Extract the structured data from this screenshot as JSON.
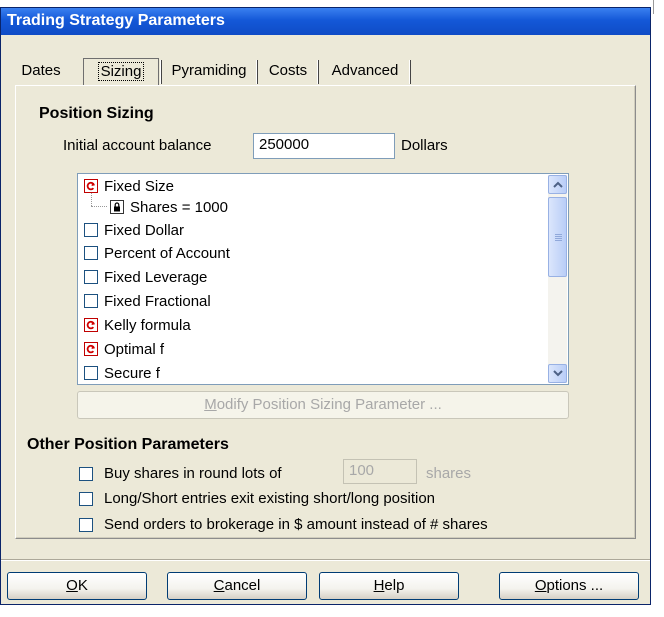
{
  "window": {
    "title": "Trading Strategy Parameters"
  },
  "tabs": [
    {
      "label": "Dates",
      "selected": false
    },
    {
      "label": "Sizing",
      "selected": true
    },
    {
      "label": "Pyramiding",
      "selected": false
    },
    {
      "label": "Costs",
      "selected": false
    },
    {
      "label": "Advanced",
      "selected": false
    }
  ],
  "position_sizing": {
    "heading": "Position Sizing",
    "balance_label": "Initial account balance",
    "balance_value": "250000",
    "balance_unit": "Dollars",
    "list_items": [
      {
        "label": "Fixed Size",
        "icon": "refresh-red-icon",
        "checked": true
      },
      {
        "label": "Shares = 1000",
        "icon": "lock-icon",
        "child": true
      },
      {
        "label": "Fixed Dollar",
        "icon": "checkbox",
        "checked": false
      },
      {
        "label": "Percent of Account",
        "icon": "checkbox",
        "checked": false
      },
      {
        "label": "Fixed Leverage",
        "icon": "checkbox",
        "checked": false
      },
      {
        "label": "Fixed Fractional",
        "icon": "checkbox",
        "checked": false
      },
      {
        "label": "Kelly formula",
        "icon": "refresh-red-icon"
      },
      {
        "label": "Optimal f",
        "icon": "refresh-red-icon"
      },
      {
        "label": "Secure f",
        "icon": "checkbox",
        "checked": false
      }
    ],
    "modify_button_pre": "",
    "modify_button_accel": "M",
    "modify_button_post": "odify Position Sizing Parameter ..."
  },
  "other_params": {
    "heading": "Other Position Parameters",
    "round_lots_label": "Buy shares in round lots of",
    "round_lots_value": "100",
    "round_lots_unit": "shares",
    "long_short_label": "Long/Short entries exit existing short/long position",
    "brokerage_label": "Send orders to brokerage in $ amount instead of # shares"
  },
  "buttons": {
    "ok_accel": "O",
    "ok_rest": "K",
    "cancel_accel": "C",
    "cancel_rest": "ancel",
    "help_accel": "H",
    "help_rest": "elp",
    "options_accel": "O",
    "options_rest": "ptions ..."
  }
}
